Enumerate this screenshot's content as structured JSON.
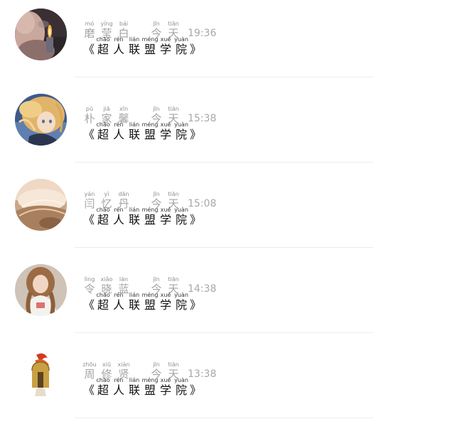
{
  "messages": [
    {
      "sender_chars": [
        {
          "py": "mó",
          "hz": "磨"
        },
        {
          "py": "yíng",
          "hz": "莹"
        },
        {
          "py": "bái",
          "hz": "白"
        }
      ],
      "date_chars": [
        {
          "py": "jīn",
          "hz": "今"
        },
        {
          "py": "tiān",
          "hz": "天"
        }
      ],
      "time": "19:36",
      "avatar": "lighter-smoke-photo"
    },
    {
      "sender_chars": [
        {
          "py": "pǔ",
          "hz": "朴"
        },
        {
          "py": "jiā",
          "hz": "家"
        },
        {
          "py": "xīn",
          "hz": "馨"
        }
      ],
      "date_chars": [
        {
          "py": "jīn",
          "hz": "今"
        },
        {
          "py": "tiān",
          "hz": "天"
        }
      ],
      "time": "15:38",
      "avatar": "anime-girl-illustration"
    },
    {
      "sender_chars": [
        {
          "py": "yán",
          "hz": "闫"
        },
        {
          "py": "yì",
          "hz": "忆"
        },
        {
          "py": "dān",
          "hz": "丹"
        }
      ],
      "date_chars": [
        {
          "py": "jīn",
          "hz": "今"
        },
        {
          "py": "tiān",
          "hz": "天"
        }
      ],
      "time": "15:08",
      "avatar": "sunlit-hair-photo"
    },
    {
      "sender_chars": [
        {
          "py": "lìng",
          "hz": "令"
        },
        {
          "py": "xiǎo",
          "hz": "晓"
        },
        {
          "py": "lán",
          "hz": "蓝"
        }
      ],
      "date_chars": [
        {
          "py": "jīn",
          "hz": "今"
        },
        {
          "py": "tiān",
          "hz": "天"
        }
      ],
      "time": "14:38",
      "avatar": "woman-portrait-photo"
    },
    {
      "sender_chars": [
        {
          "py": "zhōu",
          "hz": "周"
        },
        {
          "py": "xiū",
          "hz": "修"
        },
        {
          "py": "xián",
          "hz": "贤"
        }
      ],
      "date_chars": [
        {
          "py": "jīn",
          "hz": "今"
        },
        {
          "py": "tiān",
          "hz": "天"
        }
      ],
      "time": "13:38",
      "avatar": "spartan-helmet-icon"
    }
  ],
  "subject": {
    "open_quote": "《",
    "close_quote": "》",
    "chars": [
      {
        "py": "chāo",
        "hz": "超"
      },
      {
        "py": "rén",
        "hz": "人"
      },
      {
        "py": "lián",
        "hz": "联"
      },
      {
        "py": "méng",
        "hz": "盟"
      },
      {
        "py": "xué",
        "hz": "学"
      },
      {
        "py": "yuàn",
        "hz": "院"
      }
    ]
  }
}
